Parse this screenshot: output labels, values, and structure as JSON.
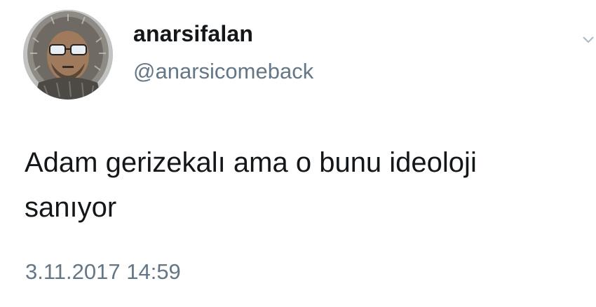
{
  "user": {
    "display_name": "anarsifalan",
    "handle": "@anarsicomeback",
    "avatar_icon": "profile-photo-man-fur-hood-sunglasses"
  },
  "menu": {
    "icon": "chevron-down-icon"
  },
  "tweet": {
    "text_line_1": "Adam gerizekalı ama o bunu ideoloji",
    "text_line_2": "sanıyor",
    "timestamp": "3.11.2017 14:59"
  },
  "colors": {
    "text_primary": "#14171a",
    "text_secondary": "#657786",
    "background": "#ffffff"
  }
}
